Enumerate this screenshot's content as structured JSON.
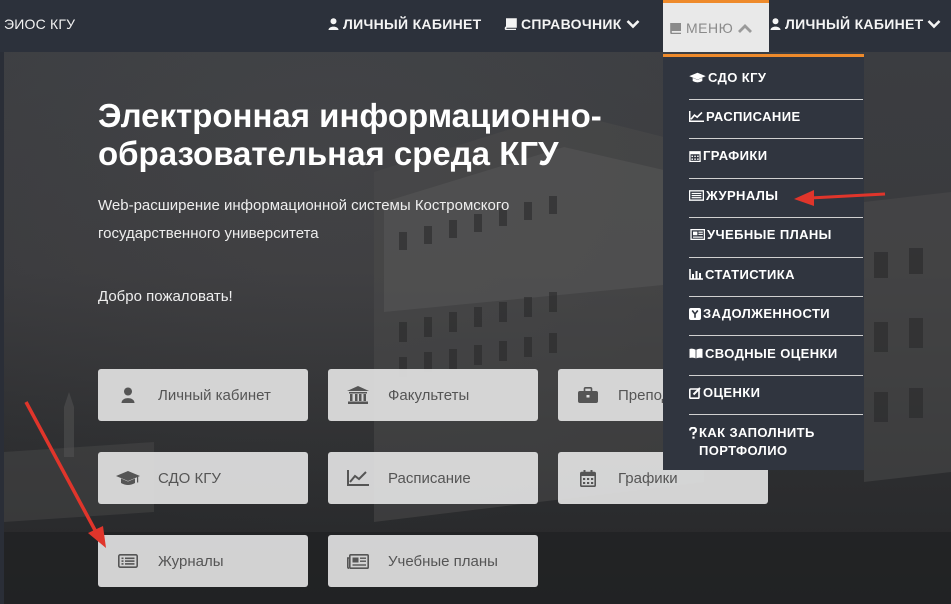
{
  "navbar": {
    "brand": "ЭИОС КГУ",
    "cabinet": "ЛИЧНЫЙ КАБИНЕТ",
    "reference": "СПРАВОЧНИК",
    "menu": "МЕНЮ",
    "cabinet2": "ЛИЧНЫЙ КАБИНЕТ"
  },
  "hero": {
    "title": "Электронная информационно-образовательная среда КГУ",
    "subtitle": "Web-расширение информационной системы Костромского государственного университета",
    "welcome": "Добро пожаловать!"
  },
  "tiles": [
    {
      "label": "Личный кабинет",
      "icon": "user-icon"
    },
    {
      "label": "Факультеты",
      "icon": "university-icon"
    },
    {
      "label": "Преподаватели",
      "icon": "briefcase-icon"
    },
    {
      "label": "СДО КГУ",
      "icon": "graduation-cap-icon"
    },
    {
      "label": "Расписание",
      "icon": "line-chart-icon"
    },
    {
      "label": "Графики",
      "icon": "calendar-icon"
    },
    {
      "label": "Журналы",
      "icon": "list-icon"
    },
    {
      "label": "Учебные планы",
      "icon": "newspaper-icon"
    }
  ],
  "menu_items": [
    {
      "label": "СДО КГУ",
      "icon": "graduation-cap-icon"
    },
    {
      "label": "РАСПИСАНИЕ",
      "icon": "line-chart-icon"
    },
    {
      "label": "ГРАФИКИ",
      "icon": "calendar-icon"
    },
    {
      "label": "ЖУРНАЛЫ",
      "icon": "list-icon"
    },
    {
      "label": "УЧЕБНЫЕ ПЛАНЫ",
      "icon": "newspaper-icon"
    },
    {
      "label": "СТАТИСТИКА",
      "icon": "bar-chart-icon"
    },
    {
      "label": "ЗАДОЛЖЕННОСТИ",
      "icon": "y-box-icon"
    },
    {
      "label": "СВОДНЫЕ ОЦЕНКИ",
      "icon": "book-icon"
    },
    {
      "label": "ОЦЕНКИ",
      "icon": "edit-icon"
    },
    {
      "label": "КАК ЗАПОЛНИТЬ ПОРТФОЛИО",
      "icon": "question-icon"
    }
  ],
  "colors": {
    "accent": "#ee8a2b",
    "navbar": "#2c313b",
    "annotation_arrow": "#e0352b"
  }
}
